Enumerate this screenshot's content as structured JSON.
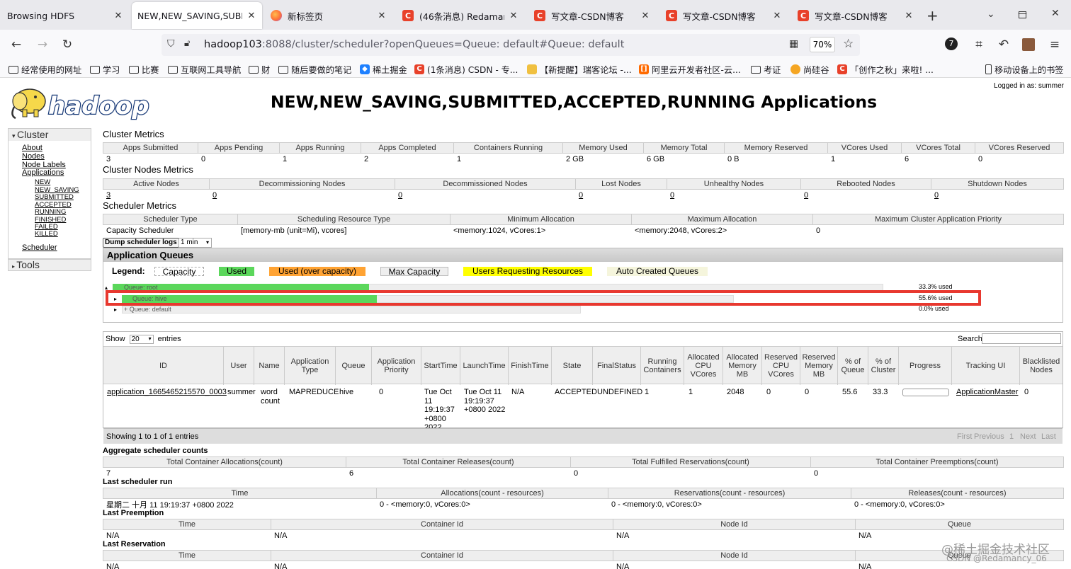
{
  "browser": {
    "tabs": [
      {
        "label": "Browsing HDFS",
        "icon": "none"
      },
      {
        "label": "NEW,NEW_SAVING,SUBMI",
        "icon": "none",
        "active": true
      },
      {
        "label": "新标签页",
        "icon": "firefox"
      },
      {
        "label": "(46条消息) Redamancy_",
        "icon": "csdn"
      },
      {
        "label": "写文章-CSDN博客",
        "icon": "csdn"
      },
      {
        "label": "写文章-CSDN博客",
        "icon": "csdn"
      },
      {
        "label": "写文章-CSDN博客",
        "icon": "csdn"
      }
    ],
    "url_host": "hadoop103",
    "url_rest": ":8088/cluster/scheduler?openQueues=Queue: default#Queue: default",
    "zoom": "70%",
    "bookmarks": [
      "经常使用的网址",
      "学习",
      "比赛",
      "互联网工具导航",
      "财",
      "随后要做的笔记",
      "稀土掘金",
      "(1条消息) CSDN - 专...",
      "【新提醒】瑞客论坛 -...",
      "阿里云开发者社区-云...",
      "考证",
      "尚硅谷",
      "「创作之秋」来啦! ...",
      "移动设备上的书签"
    ]
  },
  "page": {
    "logged_in": "Logged in as: summer",
    "title": "NEW,NEW_SAVING,SUBMITTED,ACCEPTED,RUNNING Applications",
    "sidebar": {
      "cluster": "Cluster",
      "links": [
        "About",
        "Nodes",
        "Node Labels",
        "Applications"
      ],
      "app_states": [
        "NEW",
        "NEW_SAVING",
        "SUBMITTED",
        "ACCEPTED",
        "RUNNING",
        "FINISHED",
        "FAILED",
        "KILLED"
      ],
      "scheduler": "Scheduler",
      "tools": "Tools"
    },
    "cluster_metrics": {
      "title": "Cluster Metrics",
      "headers": [
        "Apps Submitted",
        "Apps Pending",
        "Apps Running",
        "Apps Completed",
        "Containers Running",
        "Memory Used",
        "Memory Total",
        "Memory Reserved",
        "VCores Used",
        "VCores Total",
        "VCores Reserved"
      ],
      "values": [
        "3",
        "0",
        "1",
        "2",
        "1",
        "2 GB",
        "6 GB",
        "0 B",
        "1",
        "6",
        "0"
      ]
    },
    "node_metrics": {
      "title": "Cluster Nodes Metrics",
      "headers": [
        "Active Nodes",
        "Decommissioning Nodes",
        "Decommissioned Nodes",
        "Lost Nodes",
        "Unhealthy Nodes",
        "Rebooted Nodes",
        "Shutdown Nodes"
      ],
      "values": [
        "3",
        "0",
        "0",
        "0",
        "0",
        "0",
        "0"
      ]
    },
    "scheduler_metrics": {
      "title": "Scheduler Metrics",
      "headers": [
        "Scheduler Type",
        "Scheduling Resource Type",
        "Minimum Allocation",
        "Maximum Allocation",
        "Maximum Cluster Application Priority"
      ],
      "values": [
        "Capacity Scheduler",
        "[memory-mb (unit=Mi), vcores]",
        "<memory:1024, vCores:1>",
        "<memory:2048, vCores:2>",
        "0"
      ]
    },
    "dump_button": "Dump scheduler logs",
    "dump_select": "1 min",
    "queues": {
      "title": "Application Queues",
      "legend_label": "Legend:",
      "legend": [
        "Capacity",
        "Used",
        "Used (over capacity)",
        "Max Capacity",
        "Users Requesting Resources",
        "Auto Created Queues"
      ],
      "legend_colors": [
        "#ffffff",
        "#5bd75b",
        "#ffa333",
        "#eeeeee",
        "#ffff00",
        "#f5f5dc"
      ],
      "rows": [
        {
          "name": "Queue: root",
          "used": "33.3% used",
          "fill": 0.333
        },
        {
          "name": "Queue: hive",
          "used": "55.6% used",
          "fill": 0.556
        },
        {
          "name": "Queue: default",
          "used": "0.0% used",
          "fill": 0.0
        }
      ]
    },
    "apps": {
      "show": "Show",
      "entries_count": "20",
      "entries": "entries",
      "search": "Search:",
      "headers": [
        "ID",
        "User",
        "Name",
        "Application Type",
        "Queue",
        "Application Priority",
        "StartTime",
        "LaunchTime",
        "FinishTime",
        "State",
        "FinalStatus",
        "Running Containers",
        "Allocated CPU VCores",
        "Allocated Memory MB",
        "Reserved CPU VCores",
        "Reserved Memory MB",
        "% of Queue",
        "% of Cluster",
        "Progress",
        "Tracking UI",
        "Blacklisted Nodes"
      ],
      "row": [
        "application_1665465215570_0003",
        "summer",
        "word count",
        "MAPREDUCE",
        "hive",
        "0",
        "Tue Oct 11 19:19:37 +0800 2022",
        "Tue Oct 11 19:19:37 +0800 2022",
        "N/A",
        "ACCEPTED",
        "UNDEFINED",
        "1",
        "1",
        "2048",
        "0",
        "0",
        "55.6",
        "33.3",
        "",
        "ApplicationMaster",
        "0"
      ],
      "showing": "Showing 1 to 1 of 1 entries",
      "pager": [
        "First",
        "Previous",
        "1",
        "Next",
        "Last"
      ]
    },
    "aggregate": {
      "title": "Aggregate scheduler counts",
      "headers": [
        "Total Container Allocations(count)",
        "Total Container Releases(count)",
        "Total Fulfilled Reservations(count)",
        "Total Container Preemptions(count)"
      ],
      "values": [
        "7",
        "6",
        "0",
        "0"
      ]
    },
    "last_run": {
      "title": "Last scheduler run",
      "headers": [
        "Time",
        "Allocations(count - resources)",
        "Reservations(count - resources)",
        "Releases(count - resources)"
      ],
      "values": [
        "星期二 十月 11 19:19:37 +0800 2022",
        "0 - <memory:0, vCores:0>",
        "0 - <memory:0, vCores:0>",
        "0 - <memory:0, vCores:0>"
      ]
    },
    "last_preemption": {
      "title": "Last Preemption",
      "headers": [
        "Time",
        "Container Id",
        "Node Id",
        "Queue"
      ],
      "values": [
        "N/A",
        "N/A",
        "N/A",
        "N/A"
      ]
    },
    "last_reservation": {
      "title": "Last Reservation",
      "headers": [
        "Time",
        "Container Id",
        "Node Id",
        "Queue"
      ],
      "values": [
        "N/A",
        "N/A",
        "N/A",
        "N/A"
      ]
    }
  },
  "watermark": {
    "line1": "@稀土掘金技术社区",
    "line2": "CSDN @Redamancy_06"
  }
}
